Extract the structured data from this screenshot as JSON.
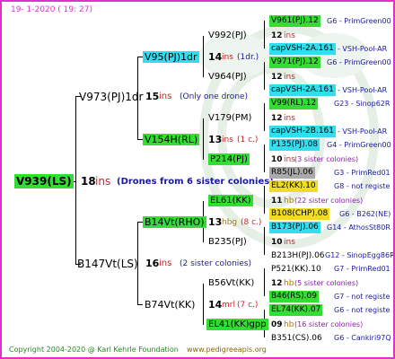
{
  "header": {
    "date": "19-   1-2020  ( 19:  27)"
  },
  "root": {
    "id": "V939(LS)",
    "gen": "18",
    "ins": "ins",
    "note": "(Drones from 6 sister colonies)"
  },
  "mother": {
    "id": "V973(PJ)1dr",
    "gen": "15",
    "ins": "ins",
    "note": "(Only one drone)"
  },
  "father": {
    "id": "B147Vt(LS)",
    "gen": "16",
    "ins": "ins",
    "note": "(2 sister colonies)"
  },
  "mm": {
    "id": "V95(PJ)1dr",
    "gen": "14",
    "ins": "ins",
    "note": "(1dr.)"
  },
  "mf": {
    "id": "V154H(RL)",
    "gen": "13",
    "ins": "ins",
    "note": "(1 c.)"
  },
  "fm": {
    "id": "B14Vt(RHO)",
    "gen": "13",
    "ins": "hbg",
    "note": "(8 c.)"
  },
  "ff": {
    "id": "B74Vt(KK)",
    "gen": "14",
    "ins": "mrl",
    "note": "(7 c.)"
  },
  "mmm": {
    "id": "V992(PJ)"
  },
  "mmf": {
    "id": "V964(PJ)"
  },
  "mfm": {
    "id": "V179(PM)"
  },
  "mff": {
    "id": "P214(PJ)"
  },
  "fmm": {
    "id": "EL61(KK)"
  },
  "fmf": {
    "id": "B235(PJ)"
  },
  "ffm": {
    "id": "B56Vt(KK)"
  },
  "ffff": {
    "id": "EL41(KK)gpp"
  },
  "r1": {
    "id": "V961(PJ).12",
    "note": "G6 - PrimGreen00"
  },
  "r2": {
    "gen": "12",
    "ins": "ins"
  },
  "r3": {
    "id": "capVSH-2A.161",
    "note": "- VSH-Pool-AR"
  },
  "r4": {
    "id": "V971(PJ).12",
    "note": "G6 - PrimGreen00"
  },
  "r5": {
    "gen": "12",
    "ins": "ins"
  },
  "r6": {
    "id": "capVSH-2A.161",
    "note": "- VSH-Pool-AR"
  },
  "r7": {
    "id": "V99(RL).12",
    "note": "G23 - Sinop62R"
  },
  "r8": {
    "gen": "12",
    "ins": "ins"
  },
  "r9": {
    "id": "capVSH-2B.161",
    "note": "- VSH-Pool-AR"
  },
  "r10": {
    "id": "P135(PJ).08",
    "note": "G4 - PrimGreen00"
  },
  "r11": {
    "gen": "10",
    "ins": "ins",
    "note": "(3 sister colonies)"
  },
  "r12": {
    "id": "R85(JL).06",
    "note": "G3 - PrimRed01"
  },
  "r13": {
    "id": "EL2(KK).10",
    "note": "G8 - not registe"
  },
  "r14": {
    "gen": "11",
    "ins": "hb",
    "note": "(22 sister colonies)"
  },
  "r15": {
    "id": "B108(CHP).08",
    "note": "G6 - B262(NE)"
  },
  "r16": {
    "id": "B173(PJ).06",
    "note": "G14 - AthosSt80R"
  },
  "r17": {
    "gen": "10",
    "ins": "ins"
  },
  "r18": {
    "id": "B213H(PJ).06",
    "note": "G12 - SinopEgg86R"
  },
  "r19": {
    "id": "P521(KK).10",
    "note": "G7 - PrimRed01"
  },
  "r20": {
    "gen": "12",
    "ins": "hb",
    "note": "(5 sister colonies)"
  },
  "r21": {
    "id": "B46(RS).09",
    "note": "G7 - not registe"
  },
  "r22": {
    "id": "EL74(KK).07",
    "note": "G6 - not registe"
  },
  "r23": {
    "gen": "09",
    "ins": "hb",
    "note": "(16 sister colonies)"
  },
  "r24": {
    "id": "B351(CS).06",
    "note": "G6 - Cankiri97Q"
  },
  "footer": {
    "copyright": "Copyright 2004-2020 @ Karl Kehrle Foundation",
    "url": "www.pedigreeapis.org"
  },
  "colors": {
    "border": "#dd33cc",
    "green_box": "#33dd33",
    "cyan_box": "#33ddee",
    "yellow_box": "#eedd22",
    "grey_box": "#aaaaaa",
    "note_blue": "#1a1aa0",
    "ins_red": "#cc2222"
  }
}
